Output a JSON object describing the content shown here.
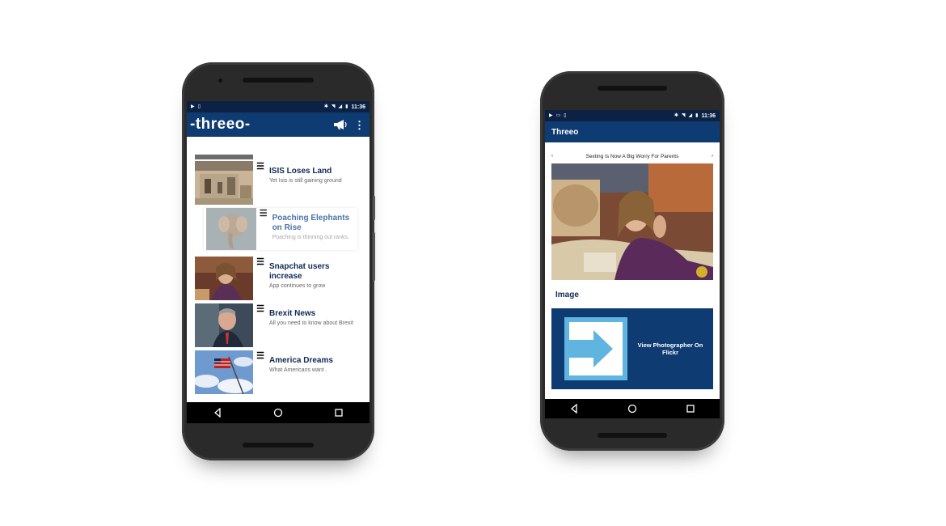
{
  "left_phone": {
    "status": {
      "time": "11:36"
    },
    "appbar": {
      "brand": "-threeo-",
      "overflow_icon": "kebab-icon",
      "action_icon": "megaphone-icon"
    },
    "feed": [
      {
        "title": "ISIS Loses Land",
        "subtitle": "Yet Isis is still gaining ground"
      },
      {
        "title": "Poaching Elephants on Rise",
        "subtitle": "Poaching is thinning out ranks."
      },
      {
        "title": "Snapchat users increase",
        "subtitle": "App continues to grow"
      },
      {
        "title": "Brexit News",
        "subtitle": "All you need to know about Brexit"
      },
      {
        "title": "America Dreams",
        "subtitle": "What Americans want ."
      }
    ]
  },
  "right_phone": {
    "status": {
      "time": "11:36"
    },
    "appbar": {
      "title": "Threeo"
    },
    "detail": {
      "caption": "Sexting Is Now A Big Worry For Parents",
      "section_label": "Image",
      "link_text": "View Photographer On Flickr"
    }
  },
  "colors": {
    "primary": "#0f3b73",
    "statusbar": "#0c2244",
    "link_icon": "#5fb4e0"
  }
}
